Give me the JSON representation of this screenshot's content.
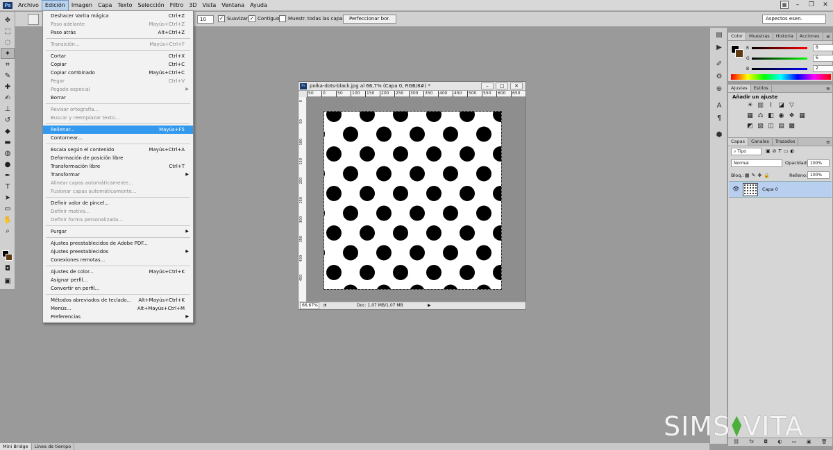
{
  "menubar": {
    "logo": "Ps",
    "items": [
      "Archivo",
      "Edición",
      "Imagen",
      "Capa",
      "Texto",
      "Selección",
      "Filtro",
      "3D",
      "Vista",
      "Ventana",
      "Ayuda"
    ],
    "active": "Edición"
  },
  "options": {
    "tolerance": "10",
    "smooth": "Suavizar",
    "contiguous": "Contiguo",
    "sample_all": "Muestr. todas las capas",
    "refine": "Perfeccionar bor.",
    "workspace": "Aspectos esen."
  },
  "edit_menu": [
    {
      "label": "Deshacer Varita mágica",
      "sc": "Ctrl+Z",
      "disabled": false
    },
    {
      "label": "Paso adelante",
      "sc": "Mayús+Ctrl+Z",
      "disabled": true
    },
    {
      "label": "Paso atrás",
      "sc": "Alt+Ctrl+Z",
      "disabled": false
    },
    {
      "sep": true
    },
    {
      "label": "Transición...",
      "sc": "Mayús+Ctrl+F",
      "disabled": true
    },
    {
      "sep": true
    },
    {
      "label": "Cortar",
      "sc": "Ctrl+X",
      "disabled": false
    },
    {
      "label": "Copiar",
      "sc": "Ctrl+C",
      "disabled": false
    },
    {
      "label": "Copiar combinado",
      "sc": "Mayús+Ctrl+C",
      "disabled": false
    },
    {
      "label": "Pegar",
      "sc": "Ctrl+V",
      "disabled": true
    },
    {
      "label": "Pegado especial",
      "sc": "",
      "disabled": true,
      "sub": true
    },
    {
      "label": "Borrar",
      "sc": "",
      "disabled": false
    },
    {
      "sep": true
    },
    {
      "label": "Revisar ortografía...",
      "sc": "",
      "disabled": true
    },
    {
      "label": "Buscar y reemplazar texto...",
      "sc": "",
      "disabled": true
    },
    {
      "sep": true
    },
    {
      "label": "Rellenar...",
      "sc": "Mayús+F5",
      "disabled": false,
      "highlight": true
    },
    {
      "label": "Contornear...",
      "sc": "",
      "disabled": false
    },
    {
      "sep": true
    },
    {
      "label": "Escala según el contenido",
      "sc": "Mayús+Ctrl+A",
      "disabled": false
    },
    {
      "label": "Deformación de posición libre",
      "sc": "",
      "disabled": false
    },
    {
      "label": "Transformación libre",
      "sc": "Ctrl+T",
      "disabled": false
    },
    {
      "label": "Transformar",
      "sc": "",
      "disabled": false,
      "sub": true
    },
    {
      "label": "Alinear capas automáticamente...",
      "sc": "",
      "disabled": true
    },
    {
      "label": "Fusionar capas automáticamente...",
      "sc": "",
      "disabled": true
    },
    {
      "sep": true
    },
    {
      "label": "Definir valor de pincel...",
      "sc": "",
      "disabled": false
    },
    {
      "label": "Definir motivo...",
      "sc": "",
      "disabled": true
    },
    {
      "label": "Definir forma personalizada...",
      "sc": "",
      "disabled": true
    },
    {
      "sep": true
    },
    {
      "label": "Purgar",
      "sc": "",
      "disabled": false,
      "sub": true
    },
    {
      "sep": true
    },
    {
      "label": "Ajustes preestablecidos de Adobe PDF...",
      "sc": "",
      "disabled": false
    },
    {
      "label": "Ajustes preestablecidos",
      "sc": "",
      "disabled": false,
      "sub": true
    },
    {
      "label": "Conexiones remotas...",
      "sc": "",
      "disabled": false
    },
    {
      "sep": true
    },
    {
      "label": "Ajustes de color...",
      "sc": "Mayús+Ctrl+K",
      "disabled": false
    },
    {
      "label": "Asignar perfil...",
      "sc": "",
      "disabled": false
    },
    {
      "label": "Convertir en perfil...",
      "sc": "",
      "disabled": false
    },
    {
      "sep": true
    },
    {
      "label": "Métodos abreviados de teclado...",
      "sc": "Alt+Mayús+Ctrl+K",
      "disabled": false
    },
    {
      "label": "Menús...",
      "sc": "Alt+Mayús+Ctrl+M",
      "disabled": false
    },
    {
      "label": "Preferencias",
      "sc": "",
      "disabled": false,
      "sub": true
    }
  ],
  "document": {
    "ps_badge": "Ps",
    "title": "polka-dots-black.jpg al 66,7% (Capa 0, RGB/8#) *",
    "ruler_h": [
      "50",
      "0",
      "50",
      "100",
      "150",
      "200",
      "250",
      "300",
      "350",
      "400",
      "450",
      "500",
      "550",
      "600",
      "650"
    ],
    "ruler_v": [
      "0",
      "50",
      "100",
      "150",
      "200",
      "250",
      "300",
      "350",
      "400",
      "450"
    ],
    "zoom": "66,67%",
    "doc_info": "Doc: 1,07 MB/1,07 MB"
  },
  "color_panel": {
    "tabs": [
      "Color",
      "Muestras",
      "Historia",
      "Acciones"
    ],
    "r": "8",
    "g": "6",
    "b": "2",
    "r_label": "R",
    "g_label": "G",
    "b_label": "B"
  },
  "adjust_panel": {
    "tabs": [
      "Ajustes",
      "Estilos"
    ],
    "title": "Añadir un ajuste"
  },
  "layers_panel": {
    "tabs": [
      "Capas",
      "Canales",
      "Trazados"
    ],
    "filter": "Tipo",
    "blend": "Normal",
    "opacity_label": "Opacidad:",
    "opacity": "100%",
    "lock_label": "Bloq.:",
    "fill_label": "Relleno:",
    "fill": "100%",
    "layer_name": "Capa 0"
  },
  "bottom_tabs": [
    "Mini Bridge",
    "Línea de tiempo"
  ],
  "watermark": {
    "left": "SIMS",
    "right": "VITA"
  },
  "colors": {
    "fg": "#000000",
    "bg": "#5e3b12",
    "highlight": "#3399ee"
  }
}
